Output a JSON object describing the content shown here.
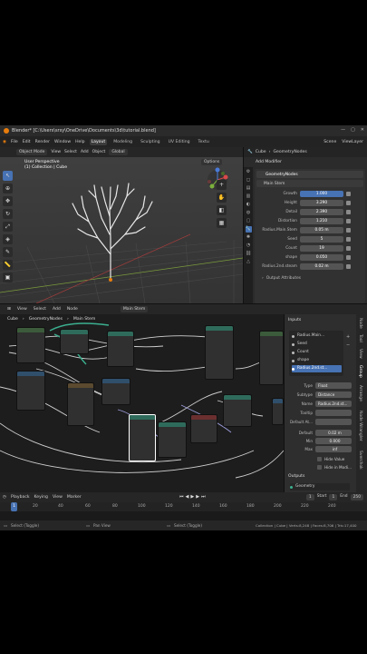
{
  "window": {
    "title": "Blender* [C:\\Users\\srsy\\OneDrive\\Documents\\3d\\tutorial.blend]"
  },
  "menubar": {
    "menus": [
      "File",
      "Edit",
      "Render",
      "Window",
      "Help"
    ],
    "workspaces": [
      "Layout",
      "Modeling",
      "Sculpting",
      "UV Editing",
      "Textu"
    ],
    "scene_label": "Scene",
    "viewlayer_label": "ViewLayer"
  },
  "viewport": {
    "mode": "Object Mode",
    "menus": [
      "View",
      "Select",
      "Add",
      "Object"
    ],
    "orientation": "Global",
    "options": "Options",
    "perspective_label": "User Perspective",
    "collection_label": "(1) Collection | Cube"
  },
  "properties": {
    "breadcrumb": [
      "Cube",
      "GeometryNodes"
    ],
    "add_modifier": "Add Modifier",
    "modifier_name": "GeometryNodes",
    "node_group": "Main Stem",
    "fields": [
      {
        "label": "Growth",
        "value": "1.000",
        "highlight": true
      },
      {
        "label": "Height",
        "value": "3.290"
      },
      {
        "label": "Detail",
        "value": "2.390"
      },
      {
        "label": "Distortion",
        "value": "1.210"
      },
      {
        "label": "Radius.Main.Stem",
        "value": "0.05 m"
      },
      {
        "label": "Seed",
        "value": "5"
      },
      {
        "label": "Count",
        "value": "19"
      },
      {
        "label": "shape",
        "value": "0.050"
      },
      {
        "label": "Radius.2nd.steam",
        "value": "0.02 m"
      }
    ],
    "output_attributes": "Output Attributes"
  },
  "node_editor": {
    "menus": [
      "View",
      "Select",
      "Add",
      "Node"
    ],
    "node_group": "Main Stem",
    "breadcrumb": [
      "Cube",
      "GeometryNodes",
      "Main Stem"
    ]
  },
  "node_sidebar": {
    "inputs_title": "Inputs",
    "inputs": [
      "Radius.Main...",
      "Seed",
      "Count",
      "shape",
      "Radius.2nd.st..."
    ],
    "active_input_index": 4,
    "type_label": "Type",
    "type_value": "Float",
    "subtype_label": "Subtype",
    "subtype_value": "Distance",
    "name_label": "Name",
    "name_value": "Radius.2nd.st...",
    "tooltip_label": "Tooltip",
    "default_attr_label": "Default At...",
    "default_label": "Default",
    "default_value": "0.02 m",
    "min_label": "Min",
    "min_value": "0.000",
    "max_label": "Max",
    "max_value": "inf",
    "hide_value": "Hide Value",
    "hide_in_modifier": "Hide in Modi...",
    "outputs_title": "Outputs",
    "output_item": "Geometry"
  },
  "side_tabs": [
    "Node",
    "Tool",
    "View",
    "Group",
    "Arrange",
    "Node Wrangler",
    "Sverchok"
  ],
  "timeline": {
    "playback": "Playback",
    "keying": "Keying",
    "menus": [
      "View",
      "Marker"
    ],
    "current_frame": "1",
    "start_label": "Start",
    "start_value": "1",
    "end_label": "End",
    "end_value": "250",
    "ticks": [
      "1",
      "20",
      "40",
      "60",
      "80",
      "100",
      "120",
      "140",
      "160",
      "180",
      "200",
      "220",
      "240"
    ]
  },
  "statusbar": {
    "left": "Select (Toggle)",
    "middle": "Pan View",
    "right_action": "Select (Toggle)",
    "stats": "Collection | Cube | Verts:8,248 | Faces:8,706 | Tris:17,400"
  },
  "colors": {
    "accent": "#4772b3",
    "header": "#262626",
    "bg": "#1d1d1d"
  }
}
